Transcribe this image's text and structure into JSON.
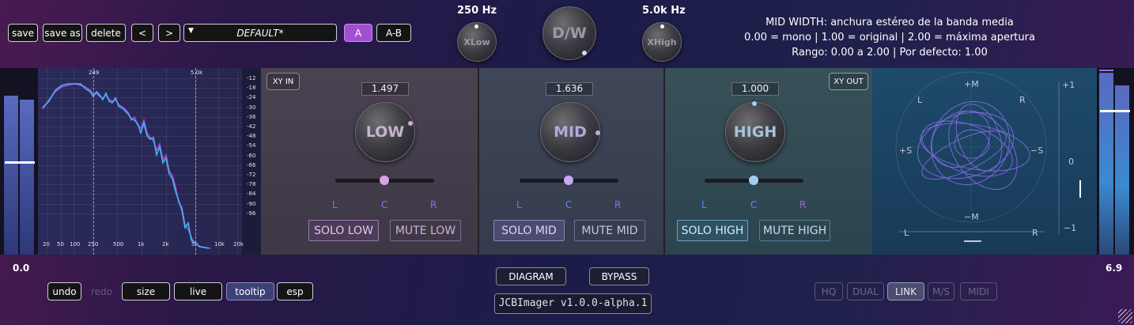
{
  "preset": {
    "save": "save",
    "save_as": "save as",
    "delete": "delete",
    "prev": "<",
    "next": ">",
    "name": "DEFAULT*",
    "a": "A",
    "ab": "A-B"
  },
  "crossover": {
    "low_freq": "250 Hz",
    "high_freq": "5.0k Hz",
    "xlow": "XLow",
    "dw": "D/W",
    "xhigh": "XHigh"
  },
  "tooltip": {
    "line1": "MID WIDTH: anchura estéreo de la banda media",
    "line2": "0.00 = mono | 1.00 = original | 2.00 = máxima apertura",
    "line3": "Rango: 0.00 a 2.00 | Por defecto: 1.00"
  },
  "spectrum": {
    "top_markers": [
      "249",
      "5.0k"
    ],
    "db_ticks": [
      "-12",
      "-18",
      "-24",
      "-30",
      "-36",
      "-42",
      "-48",
      "-54",
      "-60",
      "-66",
      "-72",
      "-78",
      "-84",
      "-90",
      "-96"
    ],
    "freq_ticks": [
      "20",
      "50",
      "100",
      "250",
      "500",
      "1k",
      "2k",
      "5k",
      "10k",
      "20k"
    ]
  },
  "bands": {
    "xy_in": "XY IN",
    "xy_out": "XY OUT",
    "low": {
      "value": "1.497",
      "label": "LOW",
      "l": "L",
      "c": "C",
      "r": "R",
      "solo": "SOLO LOW",
      "mute": "MUTE LOW",
      "color": "#d7a3e6"
    },
    "mid": {
      "value": "1.636",
      "label": "MID",
      "l": "L",
      "c": "C",
      "r": "R",
      "solo": "SOLO MID",
      "mute": "MUTE MID",
      "color": "#c8a8f0"
    },
    "high": {
      "value": "1.000",
      "label": "HIGH",
      "l": "L",
      "c": "C",
      "r": "R",
      "solo": "SOLO HIGH",
      "mute": "MUTE HIGH",
      "color": "#9fd0f0"
    }
  },
  "vectorscope": {
    "plus_m": "+M",
    "minus_m": "−M",
    "plus_s": "+S",
    "minus_s": "−S",
    "l_top": "L",
    "r_top": "R",
    "l_bot": "L",
    "r_bot": "R",
    "scale_top": "+1",
    "scale_mid": "0",
    "scale_bot": "−1"
  },
  "meters": {
    "left_value": "0.0",
    "right_value": "6.9"
  },
  "footer": {
    "undo": "undo",
    "redo": "redo",
    "size": "size",
    "live": "live",
    "tooltip": "tooltip",
    "esp": "esp",
    "diagram": "DIAGRAM",
    "bypass": "BYPASS",
    "version": "JCBImager v1.0.0-alpha.1",
    "hq": "HQ",
    "dual": "DUAL",
    "link": "LINK",
    "ms": "M/S",
    "midi": "MIDI"
  },
  "colors": {
    "accent": "#a34fd2",
    "low": "#d7a3e6",
    "mid": "#c8a8f0",
    "high": "#9fd0f0",
    "spectrum_blue": "#3fb4f0",
    "spectrum_purple": "#b040d8"
  }
}
